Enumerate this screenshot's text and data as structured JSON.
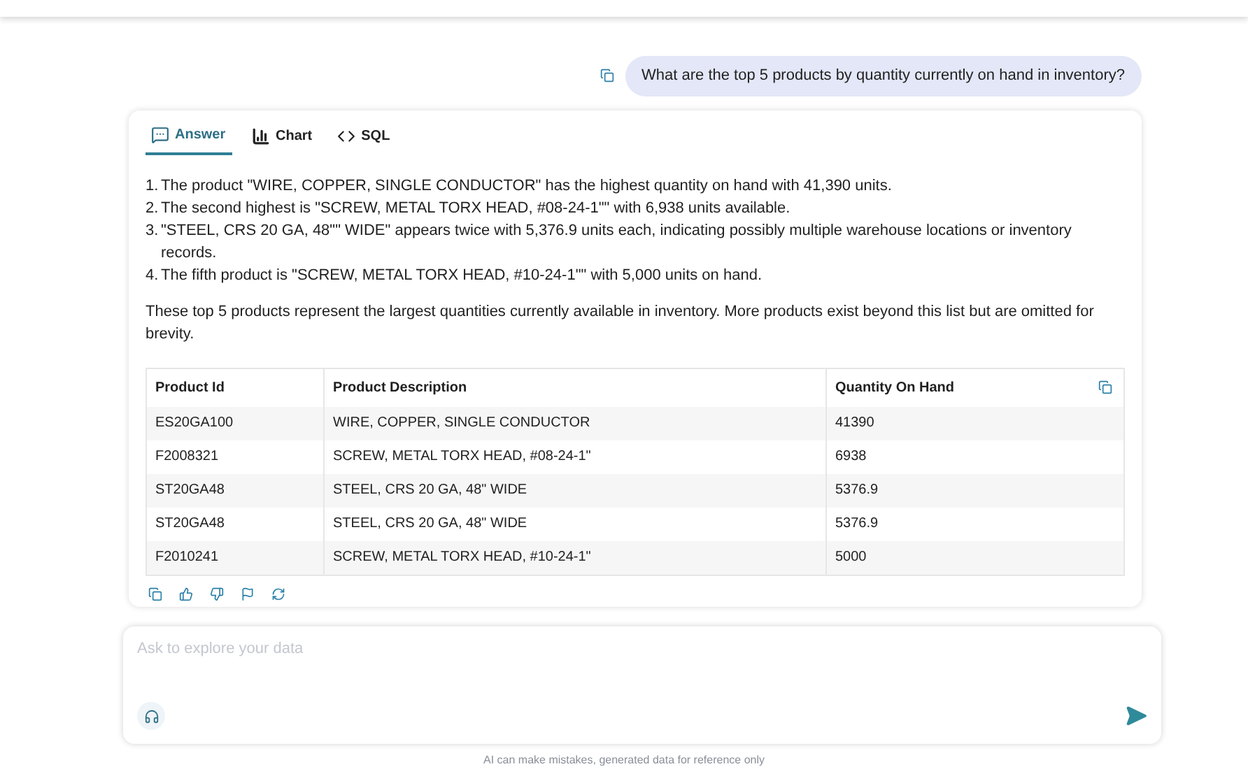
{
  "question": "What are the top 5 products by quantity currently on hand in inventory?",
  "tabs": [
    {
      "label": "Answer",
      "kind": "answer",
      "selected": true
    },
    {
      "label": "Chart",
      "kind": "chart",
      "selected": false
    },
    {
      "label": "SQL",
      "kind": "sql",
      "selected": false
    }
  ],
  "answer": {
    "items": [
      {
        "number": "1.",
        "text": "The product \"WIRE, COPPER, SINGLE CONDUCTOR\" has the highest quantity on hand with 41,390 units."
      },
      {
        "number": "2.",
        "text": "The second highest is \"SCREW, METAL TORX HEAD, #08-24-1\"\" with 6,938 units available."
      },
      {
        "number": "3.",
        "text": "\"STEEL, CRS 20 GA, 48\"\" WIDE\" appears twice with 5,376.9 units each, indicating possibly multiple warehouse locations or inventory records."
      },
      {
        "number": "4.",
        "text": "The fifth product is \"SCREW, METAL TORX HEAD, #10-24-1\"\" with 5,000 units on hand."
      }
    ],
    "summary": "These top 5 products represent the largest quantities currently available in inventory. More products exist beyond this list but are omitted for brevity."
  },
  "table": {
    "columns": [
      "Product Id",
      "Product Description",
      "Quantity On Hand"
    ],
    "rows": [
      [
        "ES20GA100",
        "WIRE, COPPER, SINGLE CONDUCTOR",
        "41390"
      ],
      [
        "F2008321",
        "SCREW, METAL TORX HEAD, #08-24-1\"",
        "6938"
      ],
      [
        "ST20GA48",
        "STEEL, CRS 20 GA, 48\" WIDE",
        "5376.9"
      ],
      [
        "ST20GA48",
        "STEEL, CRS 20 GA, 48\" WIDE",
        "5376.9"
      ],
      [
        "F2010241",
        "SCREW, METAL TORX HEAD, #10-24-1\"",
        "5000"
      ]
    ]
  },
  "input": {
    "placeholder": "Ask to explore your data"
  },
  "footer": "AI can make mistakes, generated data for reference only"
}
